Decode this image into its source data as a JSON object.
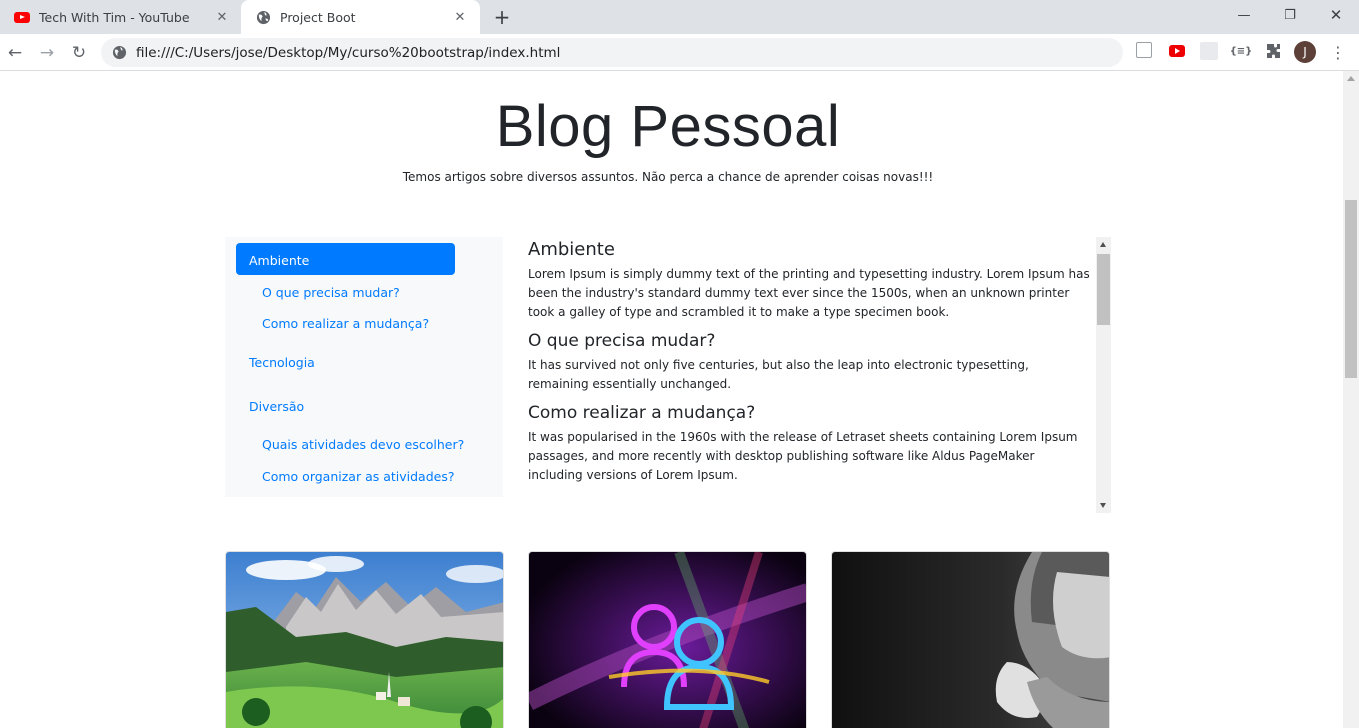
{
  "browser": {
    "tabs": [
      {
        "title": "Tech With Tim - YouTube",
        "icon": "youtube-icon",
        "active": false
      },
      {
        "title": "Project Boot",
        "icon": "globe-icon",
        "active": true
      }
    ],
    "url": "file:///C:/Users/jose/Desktop/My/curso%20bootstrap/index.html",
    "profile_initial": "J"
  },
  "page": {
    "title": "Blog Pessoal",
    "subtitle": "Temos artigos sobre diversos assuntos. Não perca a chance de aprender coisas novas!!!"
  },
  "sidebar": {
    "items": [
      {
        "label": "Ambiente",
        "active": true
      },
      {
        "label": "O que precisa mudar?"
      },
      {
        "label": "Como realizar a mudança?"
      },
      {
        "label": "Tecnologia"
      },
      {
        "label": "Diversão"
      },
      {
        "label": "Quais atividades devo escolher?"
      },
      {
        "label": "Como organizar as atividades?"
      }
    ]
  },
  "content": {
    "sections": [
      {
        "heading": "Ambiente",
        "text": "Lorem Ipsum is simply dummy text of the printing and typesetting industry. Lorem Ipsum has been the industry's standard dummy text ever since the 1500s, when an unknown printer took a galley of type and scrambled it to make a type specimen book."
      },
      {
        "heading": "O que precisa mudar?",
        "text": "It has survived not only five centuries, but also the leap into electronic typesetting, remaining essentially unchanged."
      },
      {
        "heading": "Como realizar a mudança?",
        "text": "It was popularised in the 1960s with the release of Letraset sheets containing Lorem Ipsum passages, and more recently with desktop publishing software like Aldus PageMaker including versions of Lorem Ipsum."
      }
    ]
  },
  "cards": [
    {
      "image": "mountain-landscape-image"
    },
    {
      "image": "neon-users-logo-image"
    },
    {
      "image": "praying-woman-image"
    }
  ],
  "colors": {
    "primary": "#007bff",
    "sidebar_bg": "#f8f9fa"
  }
}
